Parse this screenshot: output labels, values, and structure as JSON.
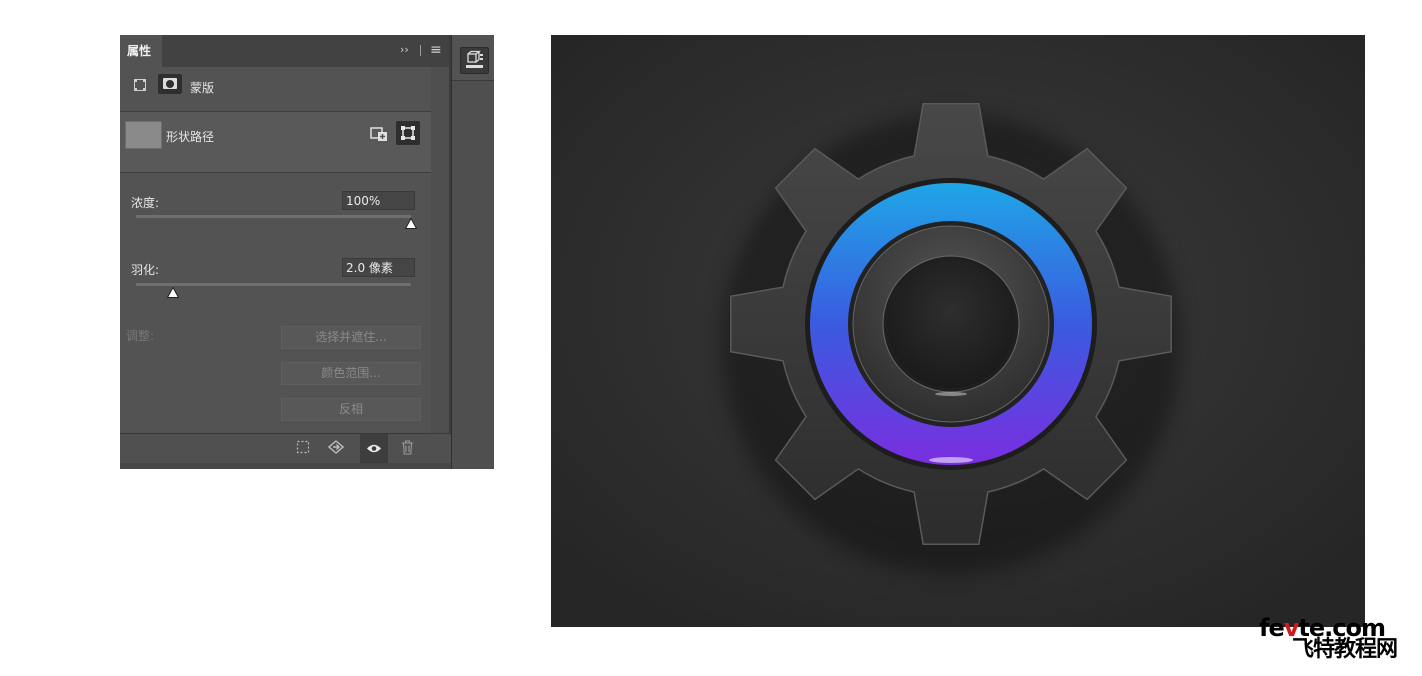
{
  "panel": {
    "tab_title": "属性",
    "expand_glyph": "››",
    "menu_glyph": "≡",
    "mode_label": "蒙版",
    "shape_label": "形状路径",
    "density": {
      "label": "浓度:",
      "value": "100%",
      "level": 1.0
    },
    "feather": {
      "label": "羽化:",
      "value": "2.0 像素",
      "level": 0.1
    },
    "adjust": {
      "label": "调整:",
      "buttons": [
        "选择并遮住...",
        "颜色范围...",
        "反相"
      ]
    },
    "footer_icons": [
      "load-selection-icon",
      "apply-mask-icon",
      "visibility-icon",
      "delete-icon"
    ],
    "side_dock_icon": "properties-3d-icon"
  },
  "artwork": {
    "subject": "gear-icon",
    "ring_colors": [
      "#1fa6e6",
      "#3a5be0",
      "#7a2ee0"
    ],
    "background_color": "#2f2f2f"
  },
  "watermark": {
    "line1_a": "fe",
    "line1_b": "v",
    "line1_c": "te.com",
    "line2": "飞特教程网"
  }
}
